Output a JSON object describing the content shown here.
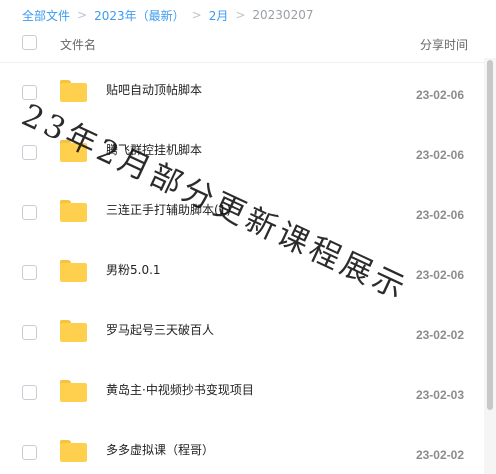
{
  "breadcrumb": {
    "items": [
      "全部文件",
      "2023年（最新）",
      "2月"
    ],
    "current": "20230207",
    "separator": ">"
  },
  "header": {
    "col_name": "文件名",
    "col_time": "分享时间"
  },
  "files": [
    {
      "name": "贴吧自动顶帖脚本",
      "date": "23-02-06"
    },
    {
      "name": "腾飞群控挂机脚本",
      "date": "23-02-06"
    },
    {
      "name": "三连正手打辅助脚本(1)",
      "date": "23-02-06"
    },
    {
      "name": "男粉5.0.1",
      "date": "23-02-06"
    },
    {
      "name": "罗马起号三天破百人",
      "date": "23-02-02"
    },
    {
      "name": "黄岛主·中视频抄书变现项目",
      "date": "23-02-03"
    },
    {
      "name": "多多虚拟课（程哥）",
      "date": "23-02-02"
    }
  ],
  "watermark": "23年2月部分更新课程展示",
  "icons": {
    "folder": "folder-icon",
    "separator": "chevron-right-icon"
  },
  "colors": {
    "link": "#3b9bf0",
    "folder": "#ffd04d"
  }
}
